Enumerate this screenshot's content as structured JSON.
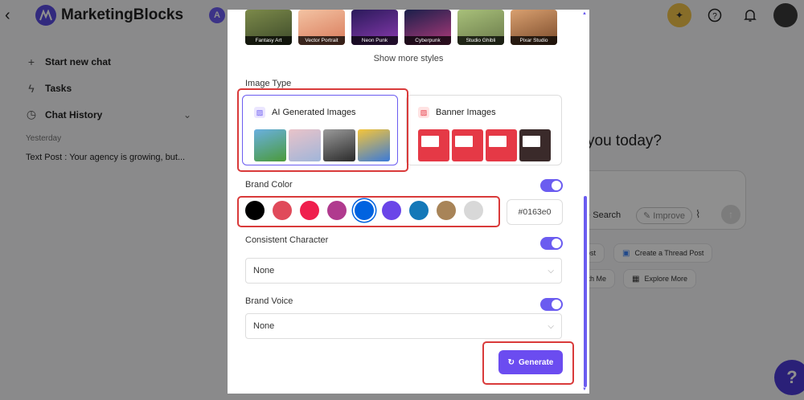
{
  "app": {
    "brand": "MarketingBlocks",
    "workspace_initial": "A",
    "sidebar": {
      "items": [
        {
          "label": "Start new chat",
          "icon": "plus-icon"
        },
        {
          "label": "Tasks",
          "icon": "bolt-icon"
        },
        {
          "label": "Chat History",
          "icon": "history-icon"
        }
      ],
      "section_label": "Yesterday",
      "history_entry": "Text Post : Your agency is growing, but..."
    },
    "greeting_partial": "you today?",
    "prompt_tools": {
      "search": "Search",
      "improve": "Improve"
    },
    "quick_actions": [
      {
        "label": "Post"
      },
      {
        "label": "Create a Thread Post"
      },
      {
        "label": "with Me"
      },
      {
        "label": "Explore More"
      }
    ]
  },
  "modal": {
    "styles": [
      {
        "label": "Fantasy Art",
        "color": "#5b6b3c"
      },
      {
        "label": "Vector Portrait",
        "color": "#e8a07a"
      },
      {
        "label": "Neon Punk",
        "color": "#4a2c7a"
      },
      {
        "label": "Cyberpunk",
        "color": "#2a2f5a"
      },
      {
        "label": "Studio Ghibli",
        "color": "#8aa05a"
      },
      {
        "label": "Pixar Studio",
        "color": "#b5784a"
      }
    ],
    "show_more": "Show more styles",
    "image_type": {
      "label": "Image Type",
      "options": [
        {
          "label": "AI Generated Images",
          "selected": true
        },
        {
          "label": "Banner Images",
          "selected": false
        }
      ]
    },
    "brand_color": {
      "label": "Brand Color",
      "enabled": true,
      "swatches": [
        "#000000",
        "#e04a5a",
        "#ef1f4d",
        "#b03a8e",
        "#0163e0",
        "#6a45e8",
        "#1478b8",
        "#a88458",
        "#d8d8d8"
      ],
      "selected": "#0163e0",
      "hex_value": "#0163e0"
    },
    "consistent_character": {
      "label": "Consistent Character",
      "enabled": true,
      "value": "None"
    },
    "brand_voice": {
      "label": "Brand Voice",
      "enabled": true,
      "value": "None"
    },
    "generate_label": "Generate"
  },
  "colors": {
    "accent": "#6b4cf0",
    "annotation": "#d93a3a"
  }
}
